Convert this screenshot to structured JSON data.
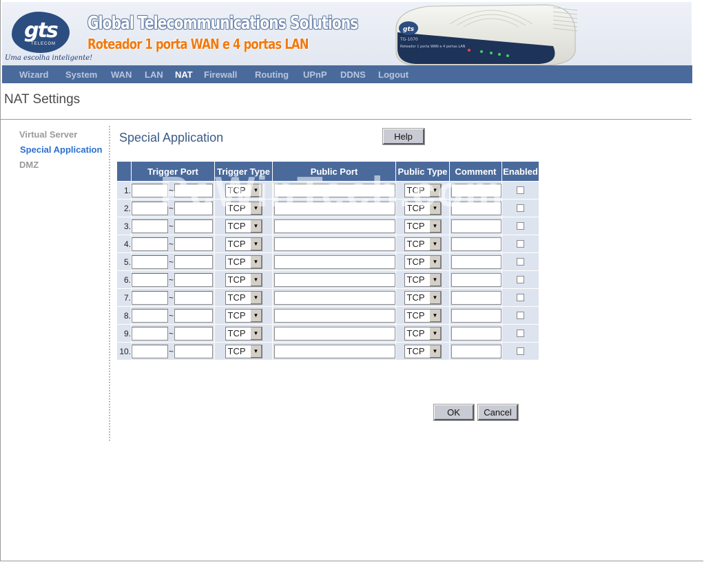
{
  "banner": {
    "logo_text": "gts",
    "logo_sub": "TELECOM",
    "tagline": "Uma escolha inteligente!",
    "title": "Global Telecommunications Solutions",
    "subtitle": "Roteador 1 porta WAN e 4 portas LAN",
    "device_model": "TG-1070",
    "device_caption": "Roteador 1 porta WAN e 4 portas LAN"
  },
  "nav": {
    "items": [
      {
        "label": "Wizard"
      },
      {
        "label": "System"
      },
      {
        "label": "WAN"
      },
      {
        "label": "LAN"
      },
      {
        "label": "NAT"
      },
      {
        "label": "Firewall"
      },
      {
        "label": "Routing"
      },
      {
        "label": "UPnP"
      },
      {
        "label": "DDNS"
      },
      {
        "label": "Logout"
      }
    ],
    "active": "NAT"
  },
  "page": {
    "title": "NAT Settings"
  },
  "sidebar": {
    "items": [
      {
        "label": "Virtual Server"
      },
      {
        "label": "Special Application"
      },
      {
        "label": "DMZ"
      }
    ],
    "active": "Special Application"
  },
  "main": {
    "section_title": "Special Application",
    "help_label": "Help",
    "ok_label": "OK",
    "cancel_label": "Cancel"
  },
  "table": {
    "headers": {
      "trigger_port": "Trigger Port",
      "trigger_type": "Trigger Type",
      "public_port": "Public Port",
      "public_type": "Public Type",
      "comment": "Comment",
      "enabled": "Enabled"
    },
    "separator": "~",
    "rows": [
      {
        "num": "1.",
        "trigger_start": "",
        "trigger_end": "",
        "trigger_type": "TCP",
        "public_port": "",
        "public_type": "TCP",
        "comment": "",
        "enabled": false
      },
      {
        "num": "2.",
        "trigger_start": "",
        "trigger_end": "",
        "trigger_type": "TCP",
        "public_port": "",
        "public_type": "TCP",
        "comment": "",
        "enabled": false
      },
      {
        "num": "3.",
        "trigger_start": "",
        "trigger_end": "",
        "trigger_type": "TCP",
        "public_port": "",
        "public_type": "TCP",
        "comment": "",
        "enabled": false
      },
      {
        "num": "4.",
        "trigger_start": "",
        "trigger_end": "",
        "trigger_type": "TCP",
        "public_port": "",
        "public_type": "TCP",
        "comment": "",
        "enabled": false
      },
      {
        "num": "5.",
        "trigger_start": "",
        "trigger_end": "",
        "trigger_type": "TCP",
        "public_port": "",
        "public_type": "TCP",
        "comment": "",
        "enabled": false
      },
      {
        "num": "6.",
        "trigger_start": "",
        "trigger_end": "",
        "trigger_type": "TCP",
        "public_port": "",
        "public_type": "TCP",
        "comment": "",
        "enabled": false
      },
      {
        "num": "7.",
        "trigger_start": "",
        "trigger_end": "",
        "trigger_type": "TCP",
        "public_port": "",
        "public_type": "TCP",
        "comment": "",
        "enabled": false
      },
      {
        "num": "8.",
        "trigger_start": "",
        "trigger_end": "",
        "trigger_type": "TCP",
        "public_port": "",
        "public_type": "TCP",
        "comment": "",
        "enabled": false
      },
      {
        "num": "9.",
        "trigger_start": "",
        "trigger_end": "",
        "trigger_type": "TCP",
        "public_port": "",
        "public_type": "TCP",
        "comment": "",
        "enabled": false
      },
      {
        "num": "10.",
        "trigger_start": "",
        "trigger_end": "",
        "trigger_type": "TCP",
        "public_port": "",
        "public_type": "TCP",
        "comment": "",
        "enabled": false
      }
    ]
  },
  "watermark": "PcWinTech.com",
  "colors": {
    "nav_bg": "#4a6a9c",
    "nav_text": "#b8c6de",
    "nav_active": "#ffffff",
    "sidebar_active": "#2a6fd0",
    "row_bg": "#dde4ef",
    "banner_subtitle": "#f07a10",
    "logo_blue": "#2c4d80"
  }
}
